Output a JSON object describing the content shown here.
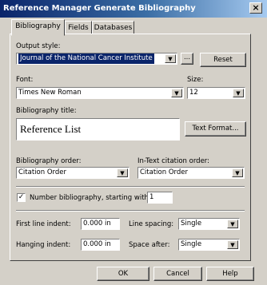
{
  "window": {
    "title": "Reference Manager Generate Bibliography",
    "close": "×"
  },
  "tabs": {
    "bibliography": "Bibliography",
    "fields": "Fields",
    "databases": "Databases"
  },
  "output_style": {
    "label": "Output style:",
    "value": "Journal of the National Cancer Institute",
    "browse_label": "...",
    "reset_label": "Reset"
  },
  "font": {
    "label": "Font:",
    "value": "Times New Roman"
  },
  "size": {
    "label": "Size:",
    "value": "12"
  },
  "bib_title": {
    "label": "Bibliography title:",
    "value": "Reference List",
    "text_format_label": "Text Format..."
  },
  "bib_order": {
    "label": "Bibliography order:",
    "value": "Citation Order"
  },
  "intext_order": {
    "label": "In-Text citation order:",
    "value": "Citation Order"
  },
  "number_bib": {
    "label": "Number bibliography, starting with:",
    "checked_glyph": "✓",
    "value": "1"
  },
  "first_indent": {
    "label": "First line indent:",
    "value": "0.000 in"
  },
  "line_spacing": {
    "label": "Line spacing:",
    "value": "Single"
  },
  "hanging_indent": {
    "label": "Hanging indent:",
    "value": "0.000 in"
  },
  "space_after": {
    "label": "Space after:",
    "value": "Single"
  },
  "buttons": {
    "ok": "OK",
    "cancel": "Cancel",
    "help": "Help"
  },
  "icons": {
    "dropdown": "▼"
  }
}
